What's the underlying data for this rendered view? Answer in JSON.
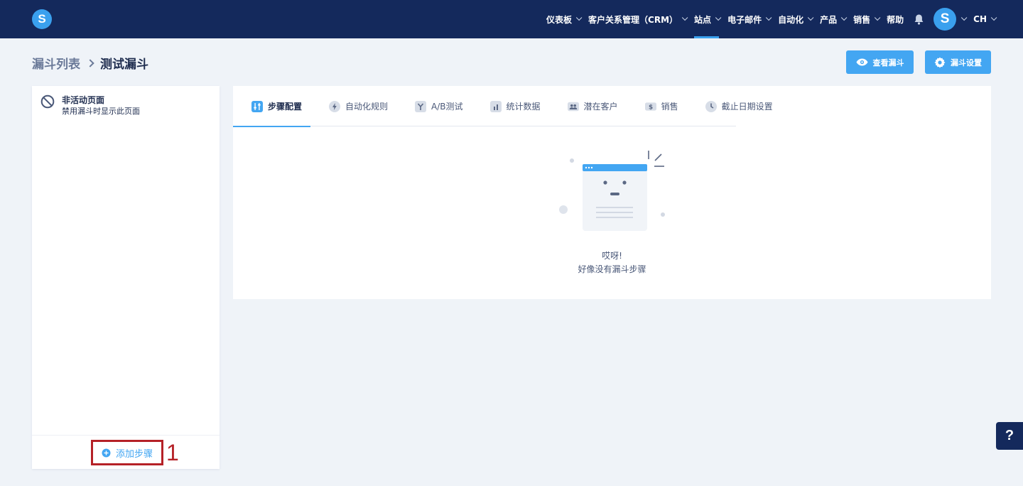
{
  "app": {
    "logo_letter": "S"
  },
  "nav": {
    "items": [
      {
        "label": "仪表板",
        "active": false
      },
      {
        "label": "客户关系管理（CRM）",
        "active": false
      },
      {
        "label": "站点",
        "active": true
      },
      {
        "label": "电子邮件",
        "active": false
      },
      {
        "label": "自动化",
        "active": false
      },
      {
        "label": "产品",
        "active": false
      },
      {
        "label": "销售",
        "active": false
      }
    ],
    "help_label": "帮助",
    "avatar_letter": "S",
    "language": "CH"
  },
  "breadcrumb": {
    "root": "漏斗列表",
    "current": "测试漏斗"
  },
  "actions": {
    "view_label": "查看漏斗",
    "settings_label": "漏斗设置"
  },
  "left_panel": {
    "inactive_title": "非活动页面",
    "inactive_subtitle": "禁用漏斗时显示此页面",
    "add_step_label": "添加步骤",
    "annotation": "1"
  },
  "tabs": [
    {
      "label": "步骤配置",
      "icon": "sliders-icon"
    },
    {
      "label": "自动化规则",
      "icon": "bolt-icon"
    },
    {
      "label": "A/B测试",
      "icon": "split-icon"
    },
    {
      "label": "统计数据",
      "icon": "bar-chart-icon"
    },
    {
      "label": "潜在客户",
      "icon": "users-icon"
    },
    {
      "label": "销售",
      "icon": "dollar-icon"
    },
    {
      "label": "截止日期设置",
      "icon": "clock-icon"
    }
  ],
  "empty_state": {
    "title": "哎呀!",
    "subtitle": "好像没有漏斗步骤"
  },
  "help_button": "?",
  "colors": {
    "nav_bg": "#14295c",
    "accent": "#43a6f2",
    "annotation": "#b52127"
  }
}
